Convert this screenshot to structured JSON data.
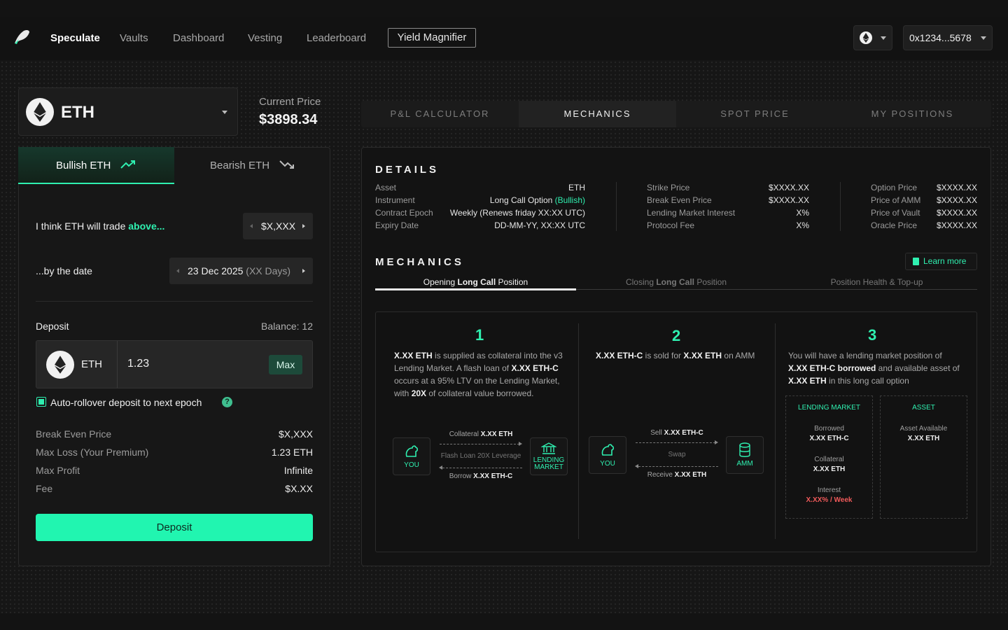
{
  "nav": {
    "items": [
      "Speculate",
      "Vaults",
      "Dashboard",
      "Vesting",
      "Leaderboard"
    ],
    "active_index": 0,
    "yield_magnifier": "Yield Magnifier",
    "wallet": "0x1234...5678"
  },
  "asset_selector": {
    "symbol": "ETH"
  },
  "price": {
    "label": "Current Price",
    "value": "$3898.34"
  },
  "trade": {
    "bull_tab": "Bullish ETH",
    "bear_tab": "Bearish ETH",
    "think_prefix": "I think ETH will trade ",
    "think_highlight": "above...",
    "strike_value": "$X,XXX",
    "by_date_label": "...by the date",
    "date_value": "23 Dec 2025",
    "date_days": "(XX Days)",
    "deposit_label": "Deposit",
    "balance": "Balance: 12",
    "deposit_asset": "ETH",
    "deposit_amount": "1.23",
    "max_label": "Max",
    "auto_rollover": "Auto-rollover deposit to next epoch",
    "summary": [
      {
        "label": "Break Even Price",
        "value": "$X,XXX"
      },
      {
        "label": "Max Loss (Your Premium)",
        "value": "1.23 ETH"
      },
      {
        "label": "Max Profit",
        "value": "Infinite"
      },
      {
        "label": "Fee",
        "value": "$X.XX"
      }
    ],
    "deposit_button": "Deposit"
  },
  "tabs": [
    "P&L CALCULATOR",
    "MECHANICS",
    "SPOT PRICE",
    "MY POSITIONS"
  ],
  "active_tab": 1,
  "details": {
    "title": "DETAILS",
    "col1": [
      {
        "label": "Asset",
        "value": "ETH"
      },
      {
        "label": "Instrument",
        "value": "Long Call Option",
        "tag": "(Bullish)"
      },
      {
        "label": "Contract Epoch",
        "value": "Weekly (Renews friday XX:XX UTC)"
      },
      {
        "label": "Expiry Date",
        "value": "DD-MM-YY, XX:XX UTC"
      }
    ],
    "col2": [
      {
        "label": "Strike Price",
        "value": "$XXXX.XX"
      },
      {
        "label": "Break Even Price",
        "value": "$XXXX.XX"
      },
      {
        "label": "Lending Market Interest",
        "value": "X%"
      },
      {
        "label": "Protocol Fee",
        "value": "X%"
      }
    ],
    "col3": [
      {
        "label": "Option Price",
        "value": "$XXXX.XX"
      },
      {
        "label": "Price of AMM",
        "value": "$XXXX.XX"
      },
      {
        "label": "Price of Vault",
        "value": "$XXXX.XX"
      },
      {
        "label": "Oracle Price",
        "value": "$XXXX.XX"
      }
    ]
  },
  "mechanics": {
    "title": "MECHANICS",
    "learn_more": "Learn more",
    "subtabs": [
      {
        "pre": "Opening ",
        "bold": "Long Call",
        "post": " Position"
      },
      {
        "pre": "Closing ",
        "bold": "Long Call",
        "post": " Position"
      },
      {
        "pre": "Position Health & Top-up",
        "bold": "",
        "post": ""
      }
    ],
    "step1": {
      "num": "1",
      "you": "YOU",
      "lending": "LENDING MARKET",
      "arrow_top_pre": "Collateral ",
      "arrow_top_bold": "X.XX ETH",
      "arrow_mid": "Flash Loan 20X Leverage",
      "arrow_bot_pre": "Borrow ",
      "arrow_bot_bold": "X.XX ETH-C"
    },
    "step2": {
      "num": "2",
      "text_b1": "X.XX ETH-C",
      "text_t1": " is sold for ",
      "text_b2": "X.XX ETH",
      "text_t2": " on AMM",
      "you": "YOU",
      "amm": "AMM",
      "arrow_top_pre": "Sell ",
      "arrow_top_bold": "X.XX ETH-C",
      "arrow_mid": "Swap",
      "arrow_bot_pre": "Receive ",
      "arrow_bot_bold": "X.XX ETH"
    },
    "step3": {
      "num": "3",
      "lm_title": "LENDING MARKET",
      "borrowed_label": "Borrowed",
      "borrowed_value": "X.XX ETH-C",
      "collateral_label": "Collateral",
      "collateral_value": "X.XX ETH",
      "interest_label": "Interest",
      "interest_value": "X.XX% / Week",
      "asset_title": "ASSET",
      "available_label": "Asset Available",
      "available_value": "X.XX ETH"
    }
  },
  "colors": {
    "accent": "#2ff0b0",
    "bg": "#131313",
    "panel": "#171717",
    "danger": "#f05a5a"
  }
}
